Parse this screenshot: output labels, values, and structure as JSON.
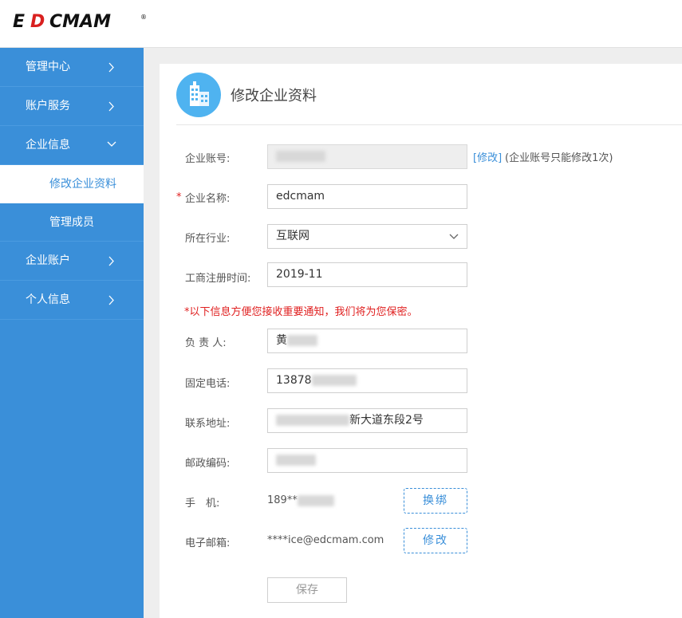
{
  "brand": {
    "logo_text": "EDCMAM",
    "logo_color": "#111111",
    "logo_accent": "#d9201f"
  },
  "sidebar": {
    "items": [
      {
        "label": "管理中心"
      },
      {
        "label": "账户服务"
      },
      {
        "label": "企业信息"
      },
      {
        "label": "修改企业资料"
      },
      {
        "label": "管理成员"
      },
      {
        "label": "企业账户"
      },
      {
        "label": "个人信息"
      }
    ]
  },
  "page": {
    "title": "修改企业资料",
    "icon": "building-icon"
  },
  "form": {
    "account_label": "企业账号:",
    "account_value": "",
    "account_edit_link": "[修改]",
    "account_hint": "(企业账号只能修改1次)",
    "name_required_mark": "*",
    "name_label": "企业名称:",
    "name_value": "edcmam",
    "industry_label": "所在行业:",
    "industry_value": "互联网",
    "reg_time_label": "工商注册时间:",
    "reg_time_value": "2019-11",
    "notice": "*以下信息方便您接收重要通知，我们将为您保密。",
    "owner_label": "负 责 人:",
    "owner_value": "黄",
    "phone_label": "固定电话:",
    "phone_value": "13878",
    "address_label": "联系地址:",
    "address_value": "新大道东段2号",
    "postcode_label": "邮政编码:",
    "postcode_value": "",
    "mobile_label": "手　机:",
    "mobile_value": "189**",
    "mobile_button": "换绑",
    "email_label": "电子邮箱:",
    "email_value": "****ice@edcmam.com",
    "email_button": "修改",
    "save_button": "保存"
  },
  "colors": {
    "sidebar": "#3a8fd9",
    "accent": "#3a8fd9",
    "required": "#e02020"
  }
}
